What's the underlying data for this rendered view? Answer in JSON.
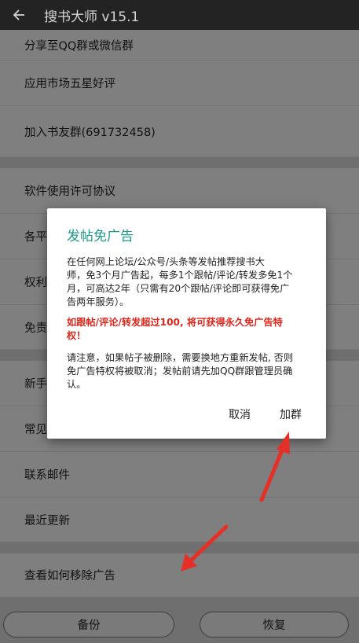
{
  "app_bar": {
    "title": "搜书大师 v15.1"
  },
  "menu": {
    "items": [
      {
        "label": "分享至QQ群或微信群"
      },
      {
        "label": "应用市场五星好评"
      },
      {
        "label": "加入书友群(691732458)"
      },
      {
        "label": "软件使用许可协议"
      },
      {
        "label": "各平"
      },
      {
        "label": "权利"
      },
      {
        "label": "免责"
      },
      {
        "label": "新手"
      },
      {
        "label": "常见"
      },
      {
        "label": "联系邮件"
      },
      {
        "label": "最近更新"
      },
      {
        "label": "查看如何移除广告"
      }
    ]
  },
  "bottom": {
    "backup_label": "备份",
    "restore_label": "恢复"
  },
  "dialog": {
    "title": "发帖免广告",
    "p1_line1": "在任何网上论坛/公众号/头条等发帖推荐搜书大",
    "p1_line2": "师，免3个月广告起，每多1个跟帖/评论/转发多免1个",
    "p1_line3": "月，可高达2年（只需有20个跟帖/评论即可获得免广",
    "p1_line4": "告两年服务）。",
    "p2_line1": "如跟帖/评论/转发超过100, 将可获得永久免广告特",
    "p2_line2": "权！",
    "p3_line1": "请注意，如果帖子被删除，需要换地方重新发帖, 否则",
    "p3_line2": "免广告特权将被取消；发帖前请先加QQ群跟管理员确",
    "p3_line3": "认。",
    "cancel_label": "取消",
    "join_label": "加群"
  },
  "colors": {
    "dialog_title": "#1e9a86",
    "highlight": "#e0261c",
    "annotation_arrow": "#e53027"
  }
}
